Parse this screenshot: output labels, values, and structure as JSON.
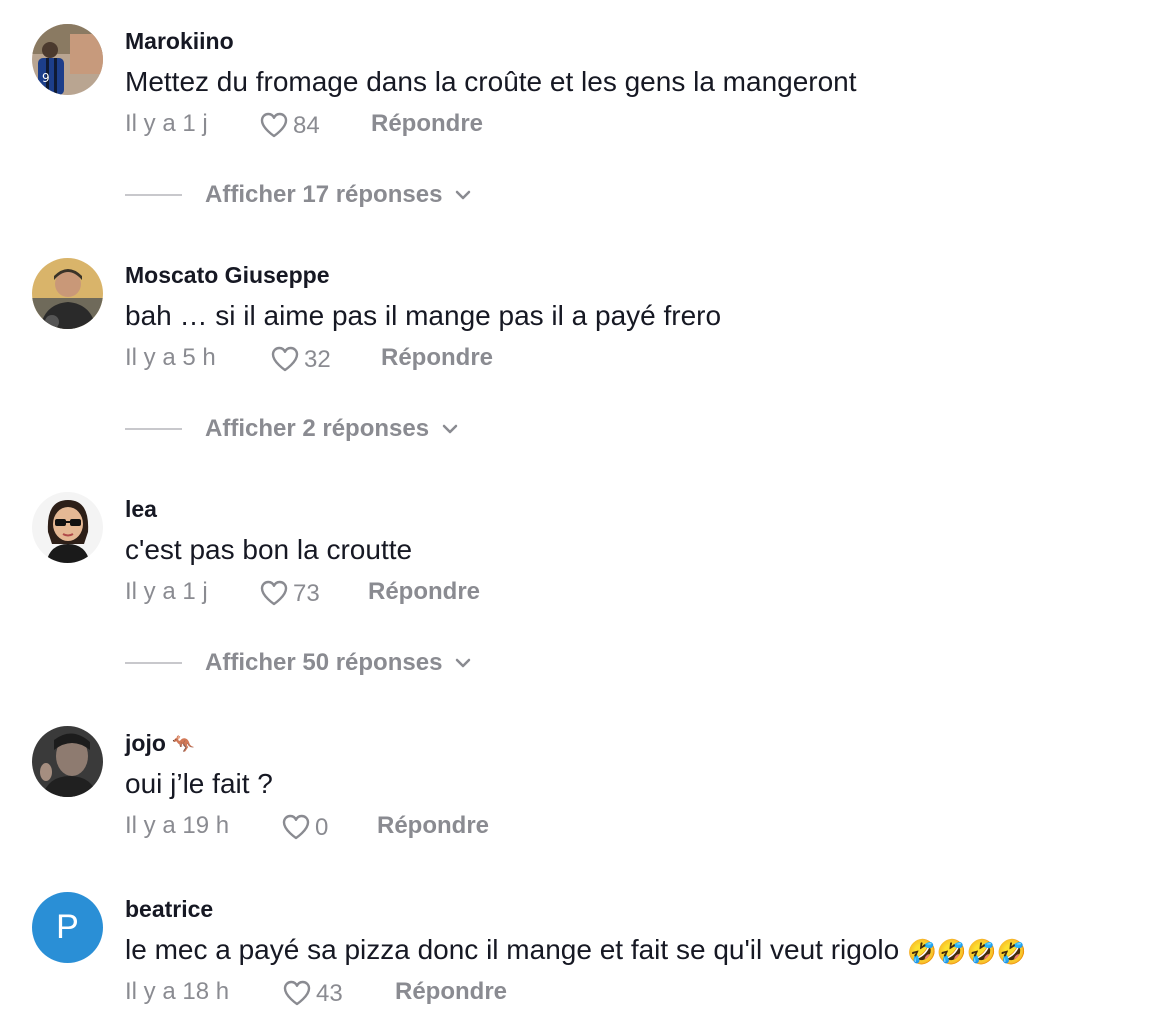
{
  "comments": [
    {
      "username": "Marokiino",
      "text": "Mettez du fromage dans la croûte et les gens la mangeront",
      "time": "Il y a 1 j",
      "likes": "84",
      "reply_label": "Répondre",
      "view_replies": "Afficher 17 réponses"
    },
    {
      "username": "Moscato Giuseppe",
      "text": "bah … si il aime pas il mange pas il a payé frero",
      "time": "Il y a 5 h",
      "likes": "32",
      "reply_label": "Répondre",
      "view_replies": "Afficher 2 réponses"
    },
    {
      "username": "lea",
      "text": "c'est pas bon la croutte",
      "time": "Il y a 1 j",
      "likes": "73",
      "reply_label": "Répondre",
      "view_replies": "Afficher 50 réponses"
    },
    {
      "username": "jojo",
      "username_emoji": "🦘",
      "text": "oui j’le fait ?",
      "time": "Il y a 19 h",
      "likes": "0",
      "reply_label": "Répondre"
    },
    {
      "username": "beatrice",
      "avatar_letter": "P",
      "text": "le mec a payé sa pizza donc il mange et fait se qu'il veut rigolo",
      "text_emoji": "🤣🤣🤣🤣",
      "time": "Il y a 18 h",
      "likes": "43",
      "reply_label": "Répondre"
    }
  ],
  "icons": {
    "like": "heart-outline-icon",
    "expand": "chevron-down-icon"
  },
  "colors": {
    "text": "#161823",
    "muted": "#8a8b91",
    "avatar_letter_bg": "#2a8fd6"
  }
}
